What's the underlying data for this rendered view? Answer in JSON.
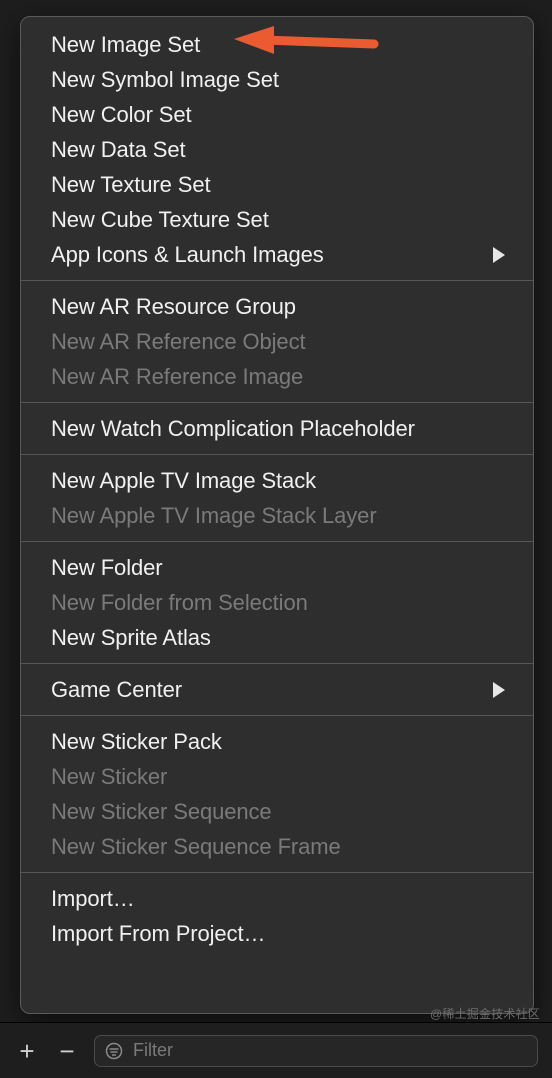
{
  "menu": {
    "groups": [
      {
        "items": [
          {
            "label": "New Image Set",
            "enabled": true,
            "submenu": false,
            "id": "new-image-set"
          },
          {
            "label": "New Symbol Image Set",
            "enabled": true,
            "submenu": false,
            "id": "new-symbol-image-set"
          },
          {
            "label": "New Color Set",
            "enabled": true,
            "submenu": false,
            "id": "new-color-set"
          },
          {
            "label": "New Data Set",
            "enabled": true,
            "submenu": false,
            "id": "new-data-set"
          },
          {
            "label": "New Texture Set",
            "enabled": true,
            "submenu": false,
            "id": "new-texture-set"
          },
          {
            "label": "New Cube Texture Set",
            "enabled": true,
            "submenu": false,
            "id": "new-cube-texture-set"
          },
          {
            "label": "App Icons & Launch Images",
            "enabled": true,
            "submenu": true,
            "id": "app-icons-launch-images"
          }
        ]
      },
      {
        "items": [
          {
            "label": "New AR Resource Group",
            "enabled": true,
            "submenu": false,
            "id": "new-ar-resource-group"
          },
          {
            "label": "New AR Reference Object",
            "enabled": false,
            "submenu": false,
            "id": "new-ar-reference-object"
          },
          {
            "label": "New AR Reference Image",
            "enabled": false,
            "submenu": false,
            "id": "new-ar-reference-image"
          }
        ]
      },
      {
        "items": [
          {
            "label": "New Watch Complication Placeholder",
            "enabled": true,
            "submenu": false,
            "id": "new-watch-complication-placeholder"
          }
        ]
      },
      {
        "items": [
          {
            "label": "New Apple TV Image Stack",
            "enabled": true,
            "submenu": false,
            "id": "new-apple-tv-image-stack"
          },
          {
            "label": "New Apple TV Image Stack Layer",
            "enabled": false,
            "submenu": false,
            "id": "new-apple-tv-image-stack-layer"
          }
        ]
      },
      {
        "items": [
          {
            "label": "New Folder",
            "enabled": true,
            "submenu": false,
            "id": "new-folder"
          },
          {
            "label": "New Folder from Selection",
            "enabled": false,
            "submenu": false,
            "id": "new-folder-from-selection"
          },
          {
            "label": "New Sprite Atlas",
            "enabled": true,
            "submenu": false,
            "id": "new-sprite-atlas"
          }
        ]
      },
      {
        "items": [
          {
            "label": "Game Center",
            "enabled": true,
            "submenu": true,
            "id": "game-center"
          }
        ]
      },
      {
        "items": [
          {
            "label": "New Sticker Pack",
            "enabled": true,
            "submenu": false,
            "id": "new-sticker-pack"
          },
          {
            "label": "New Sticker",
            "enabled": false,
            "submenu": false,
            "id": "new-sticker"
          },
          {
            "label": "New Sticker Sequence",
            "enabled": false,
            "submenu": false,
            "id": "new-sticker-sequence"
          },
          {
            "label": "New Sticker Sequence Frame",
            "enabled": false,
            "submenu": false,
            "id": "new-sticker-sequence-frame"
          }
        ]
      },
      {
        "items": [
          {
            "label": "Import…",
            "enabled": true,
            "submenu": false,
            "id": "import"
          },
          {
            "label": "Import From Project…",
            "enabled": true,
            "submenu": false,
            "id": "import-from-project"
          }
        ]
      }
    ]
  },
  "toolbar": {
    "plus": "+",
    "minus": "−",
    "filter_placeholder": "Filter"
  },
  "watermark": "@稀土掘金技术社区",
  "arrow_color": "#ea5b32"
}
